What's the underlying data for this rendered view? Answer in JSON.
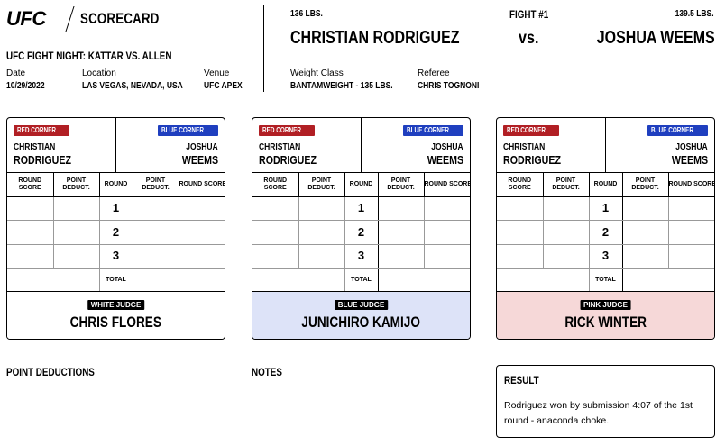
{
  "header": {
    "logo": "UFC",
    "title": "SCORECARD",
    "event": "UFC FIGHT NIGHT: KATTAR VS. ALLEN",
    "date_label": "Date",
    "date": "10/29/2022",
    "location_label": "Location",
    "location": "LAS VEGAS, NEVADA, USA",
    "venue_label": "Venue",
    "venue": "UFC APEX"
  },
  "fight": {
    "number": "FIGHT #1",
    "red_weight": "136 LBS.",
    "red_name": "CHRISTIAN RODRIGUEZ",
    "vs": "vs.",
    "blue_weight": "139.5 LBS.",
    "blue_name": "JOSHUA WEEMS",
    "weight_class_label": "Weight Class",
    "weight_class": "BANTAMWEIGHT - 135 LBS.",
    "referee_label": "Referee",
    "referee": "CHRIS TOGNONI"
  },
  "card_labels": {
    "red_corner": "RED CORNER",
    "blue_corner": "BLUE CORNER",
    "red_first": "CHRISTIAN",
    "red_last": "RODRIGUEZ",
    "blue_first": "JOSHUA",
    "blue_last": "WEEMS",
    "round_score": "ROUND SCORE",
    "point_deduct": "POINT DEDUCT.",
    "round": "ROUND",
    "rounds": [
      "1",
      "2",
      "3"
    ],
    "total": "TOTAL"
  },
  "judges": [
    {
      "tag": "WHITE JUDGE",
      "name": "CHRIS FLORES",
      "color": "#ffffff"
    },
    {
      "tag": "BLUE JUDGE",
      "name": "JUNICHIRO KAMIJO",
      "color": "#dde3f8"
    },
    {
      "tag": "PINK JUDGE",
      "name": "RICK WINTER",
      "color": "#f6d8d8"
    }
  ],
  "sections": {
    "point_deductions": "POINT DEDUCTIONS",
    "notes": "NOTES",
    "result_title": "RESULT",
    "result_text": "Rodriguez won by submission 4:07 of the 1st round - anaconda choke."
  }
}
